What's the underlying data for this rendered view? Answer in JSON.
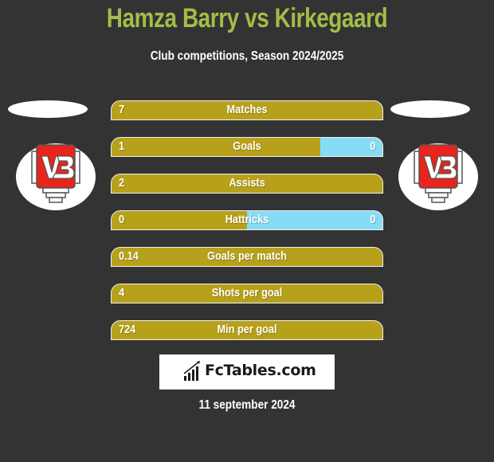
{
  "header": {
    "title": "Hamza Barry vs Kirkegaard",
    "subtitle": "Club competitions, Season 2024/2025"
  },
  "players": {
    "left": {
      "name": "Hamza Barry",
      "club_logo": "vejle-boldklub-crest-icon"
    },
    "right": {
      "name": "Kirkegaard",
      "club_logo": "vejle-boldklub-crest-icon"
    }
  },
  "colors": {
    "background": "#333333",
    "title": "#a3bd47",
    "left_bar": "#b8a11a",
    "right_bar": "#87dcf5",
    "text": "#ffffff"
  },
  "stats": [
    {
      "label": "Matches",
      "left": "7",
      "right": "",
      "left_share": 1.0
    },
    {
      "label": "Goals",
      "left": "1",
      "right": "0",
      "left_share": 0.77
    },
    {
      "label": "Assists",
      "left": "2",
      "right": "",
      "left_share": 1.0
    },
    {
      "label": "Hattricks",
      "left": "0",
      "right": "0",
      "left_share": 0.5
    },
    {
      "label": "Goals per match",
      "left": "0.14",
      "right": "",
      "left_share": 1.0
    },
    {
      "label": "Shots per goal",
      "left": "4",
      "right": "",
      "left_share": 1.0
    },
    {
      "label": "Min per goal",
      "left": "724",
      "right": "",
      "left_share": 1.0
    }
  ],
  "footer": {
    "brand": "FcTables.com",
    "brand_icon": "bar-chart-icon",
    "date": "11 september 2024"
  }
}
